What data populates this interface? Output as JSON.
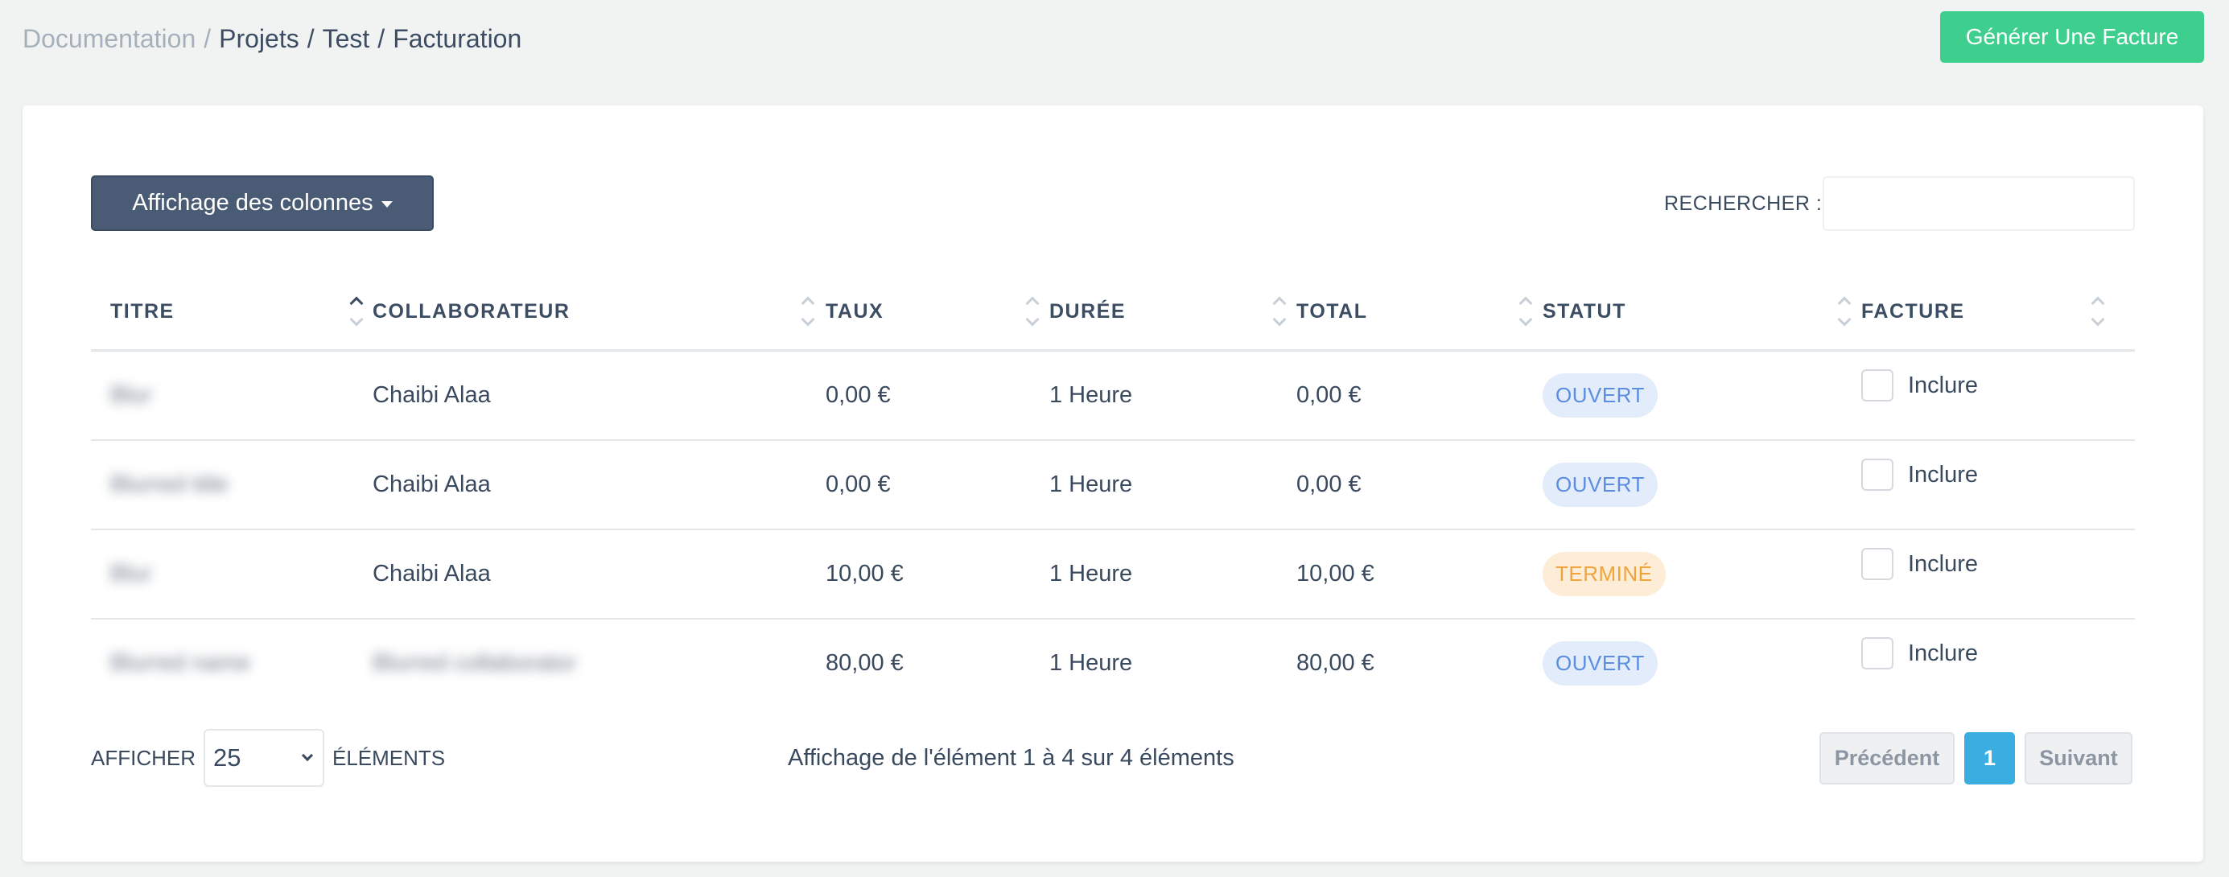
{
  "breadcrumb": {
    "root": "Documentation",
    "items": [
      "Projets",
      "Test",
      "Facturation"
    ]
  },
  "header": {
    "generate_button": "Générer Une Facture"
  },
  "toolbar": {
    "columns_button": "Affichage des colonnes",
    "search_label": "RECHERCHER :",
    "search_value": ""
  },
  "table": {
    "headers": {
      "titre": "TITRE",
      "collaborateur": "COLLABORATEUR",
      "taux": "TAUX",
      "duree": "DURÉE",
      "total": "TOTAL",
      "statut": "STATUT",
      "facture": "FACTURE"
    },
    "sorted_column": "titre",
    "sort_direction": "ascending",
    "rows": [
      {
        "titre": "Blur",
        "collaborateur": "Chaibi Alaa",
        "taux": "0,00 €",
        "duree": "1 Heure",
        "total": "0,00 €",
        "statut": "OUVERT",
        "facture_label": "Inclure"
      },
      {
        "titre": "Blurred title",
        "collaborateur": "Chaibi Alaa",
        "taux": "0,00 €",
        "duree": "1 Heure",
        "total": "0,00 €",
        "statut": "OUVERT",
        "facture_label": "Inclure"
      },
      {
        "titre": "Blur",
        "collaborateur": "Chaibi Alaa",
        "taux": "10,00 €",
        "duree": "1 Heure",
        "total": "10,00 €",
        "statut": "TERMINÉ",
        "facture_label": "Inclure"
      },
      {
        "titre": "Blurred name",
        "collaborateur": "Blurred collaborator",
        "taux": "80,00 €",
        "duree": "1 Heure",
        "total": "80,00 €",
        "statut": "OUVERT",
        "facture_label": "Inclure"
      }
    ]
  },
  "footer": {
    "show_label": "AFFICHER",
    "page_size": "25",
    "elements_label": "ÉLÉMENTS",
    "info": "Affichage de l'élément 1 à 4 sur 4 éléments",
    "prev": "Précédent",
    "page": "1",
    "next": "Suivant"
  },
  "colors": {
    "accent_green": "#3ecf8e",
    "columns_button": "#4a5c75",
    "badge_open_bg": "#e3ecfb",
    "badge_open_text": "#5b8de0",
    "badge_done_bg": "#fdecd6",
    "badge_done_text": "#f0a43c",
    "active_page": "#3aaee0"
  }
}
